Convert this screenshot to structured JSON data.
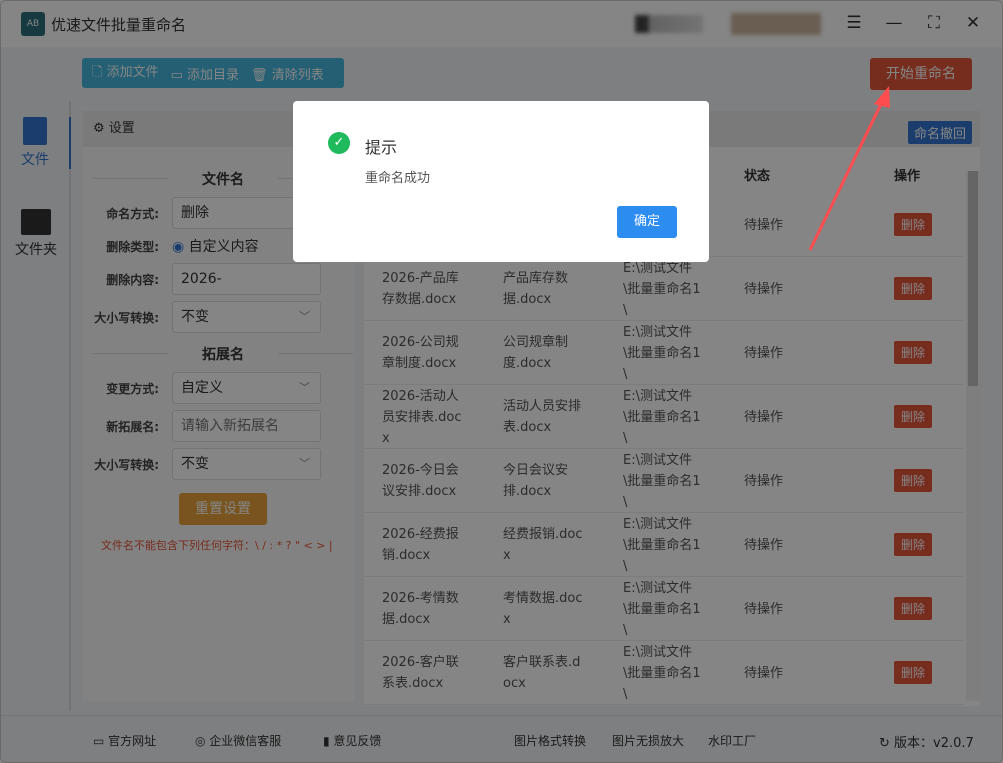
{
  "app": {
    "title": "优速文件批量重命名",
    "logo_text": "AB"
  },
  "window_controls": {
    "menu": "☰",
    "minimize": "—",
    "maximize": "⛶",
    "close": "✕"
  },
  "toolbar": {
    "add_file": "添加文件",
    "add_folder": "添加目录",
    "clear_list": "清除列表",
    "start": "开始重命名"
  },
  "sidebar": {
    "items": [
      {
        "label": "文件",
        "icon": "file-icon",
        "active": true
      },
      {
        "label": "文件夹",
        "icon": "folder-icon",
        "active": false
      }
    ]
  },
  "settings": {
    "title": "设置",
    "filename_section": "文件名",
    "naming_mode_label": "命名方式:",
    "naming_mode": "删除",
    "delete_type_label": "删除类型:",
    "delete_type_option": "自定义内容",
    "delete_content_label": "删除内容:",
    "delete_content": "2026-",
    "case_label": "大小写转换:",
    "case_value": "不变",
    "ext_section": "拓展名",
    "change_mode_label": "变更方式:",
    "change_mode": "自定义",
    "new_ext_label": "新拓展名:",
    "new_ext_placeholder": "请输入新拓展名",
    "ext_case_label": "大小写转换:",
    "ext_case_value": "不变",
    "reset": "重置设置",
    "warning": "文件名不能包含下列任何字符：\\ / : * ? \" < > |"
  },
  "table": {
    "undo": "命名撤回",
    "headers": {
      "status": "状态",
      "action": "操作"
    },
    "rows": [
      {
        "old": "",
        "new": "",
        "path": "",
        "status": "待操作",
        "action": "删除"
      },
      {
        "old": "2026-产品库\n存数据.docx",
        "new": "产品库存数\n据.docx",
        "path": "E:\\测试文件\n\\批量重命名1\n\\",
        "status": "待操作",
        "action": "删除"
      },
      {
        "old": "2026-公司规\n章制度.docx",
        "new": "公司规章制\n度.docx",
        "path": "E:\\测试文件\n\\批量重命名1\n\\",
        "status": "待操作",
        "action": "删除"
      },
      {
        "old": "2026-活动人\n员安排表.doc\nx",
        "new": "活动人员安排\n表.docx",
        "path": "E:\\测试文件\n\\批量重命名1\n\\",
        "status": "待操作",
        "action": "删除"
      },
      {
        "old": "2026-今日会\n议安排.docx",
        "new": "今日会议安\n排.docx",
        "path": "E:\\测试文件\n\\批量重命名1\n\\",
        "status": "待操作",
        "action": "删除"
      },
      {
        "old": "2026-经费报\n销.docx",
        "new": "经费报销.doc\nx",
        "path": "E:\\测试文件\n\\批量重命名1\n\\",
        "status": "待操作",
        "action": "删除"
      },
      {
        "old": "2026-考情数\n据.docx",
        "new": "考情数据.doc\nx",
        "path": "E:\\测试文件\n\\批量重命名1\n\\",
        "status": "待操作",
        "action": "删除"
      },
      {
        "old": "2026-客户联\n系表.docx",
        "new": "客户联系表.d\nocx",
        "path": "E:\\测试文件\n\\批量重命名1\n\\",
        "status": "待操作",
        "action": "删除"
      }
    ]
  },
  "footer": {
    "website": "官方网址",
    "wechat": "企业微信客服",
    "feedback": "意见反馈",
    "img_convert": "图片格式转换",
    "img_enlarge": "图片无损放大",
    "watermark": "水印工厂",
    "version": "版本：v2.0.7"
  },
  "dialog": {
    "title": "提示",
    "message": "重命名成功",
    "ok": "确定"
  },
  "colors": {
    "primary": "#3476d2",
    "toolbar": "#45b6dd",
    "danger": "#e2573a",
    "warning": "#e8a23a",
    "success": "#1fba5b",
    "dialog_ok": "#2d8cf0",
    "annotation_arrow": "#ff4d4f"
  }
}
